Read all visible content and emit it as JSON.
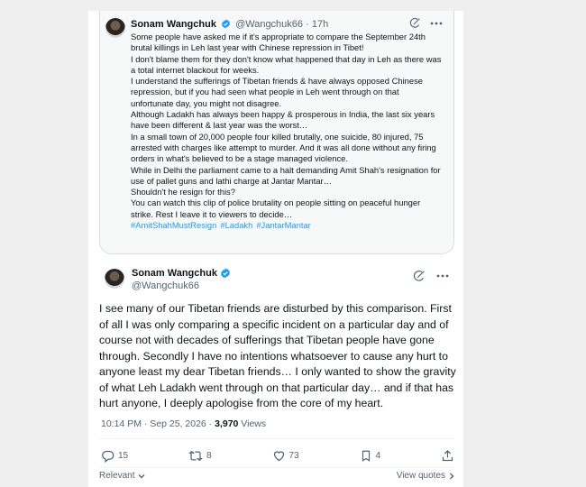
{
  "quoted": {
    "author_name": "Sonam Wangchuk",
    "handle": "@Wangchuk66",
    "separator": "·",
    "time": "17h",
    "paragraphs": [
      "Some people have asked me if it's appropriate to compare the September 24th brutal killings in Leh last year with Chinese repression in Tibet!",
      "I don't blame them for they don't know what happened that day in Leh as there was a total internet blackout for weeks.",
      "I understand the sufferings of Tibetan friends & have always opposed Chinese repression, but if you had seen what people in Leh went through on that unfortunate day, you might not disagree.",
      "Although Ladakh has always been happy & prosperous in India, the last six years have been different & last year was the worst…",
      "In a small town of 20,000 people four killed brutally, one suicide, 80 injured, 75 arrested with charges like attempt to murder. And it was all done without any firing orders in what's believed to be a stage managed violence.",
      "While in Delhi the parliament came to a halt demanding Amit Shah's resignation for use of pallet guns and lathi charge at Jantar Mantar…",
      "Shouldn't he resign for this?",
      "You can watch this clip of police brutality on people sitting on peaceful hunger strike. Rest I leave it to viewers to decide…"
    ],
    "hashtags": [
      "#AmitShahMustResign",
      "#Ladakh",
      "#JantarMantar"
    ]
  },
  "tweet": {
    "author_name": "Sonam Wangchuk",
    "handle": "@Wangchuk66",
    "text": "I see many of our Tibetan friends are disturbed by this comparison. First of all I was only comparing a specific incident on a particular day and of course not with decades of sufferings that Tibetan people have gone through. Secondly I have no intentions whatsoever to cause any hurt to anyone least my dear Tibetan friends… I only wanted to show the gravity of what Leh Ladakh went through on that particular day… and if that has hurt anyone, I deeply apologise from the core of my heart.",
    "timestamp": "10:14 PM · Sep 25, 2026",
    "separator": "·",
    "views_count": "3,970",
    "views_label": "Views"
  },
  "actions": {
    "replies": "15",
    "reposts": "8",
    "likes": "73",
    "bookmarks": "4"
  },
  "footer": {
    "relevant_label": "Relevant",
    "view_quotes_label": "View quotes"
  },
  "colors": {
    "accent": "#1d9bf0",
    "text": "#0f1419",
    "muted": "#536471",
    "background": "#efefef"
  },
  "icons": [
    "verified-badge-icon",
    "grok-icon",
    "more-icon",
    "reply-icon",
    "repost-icon",
    "like-icon",
    "bookmark-icon",
    "share-icon",
    "chevron-down-icon",
    "chevron-right-icon"
  ]
}
